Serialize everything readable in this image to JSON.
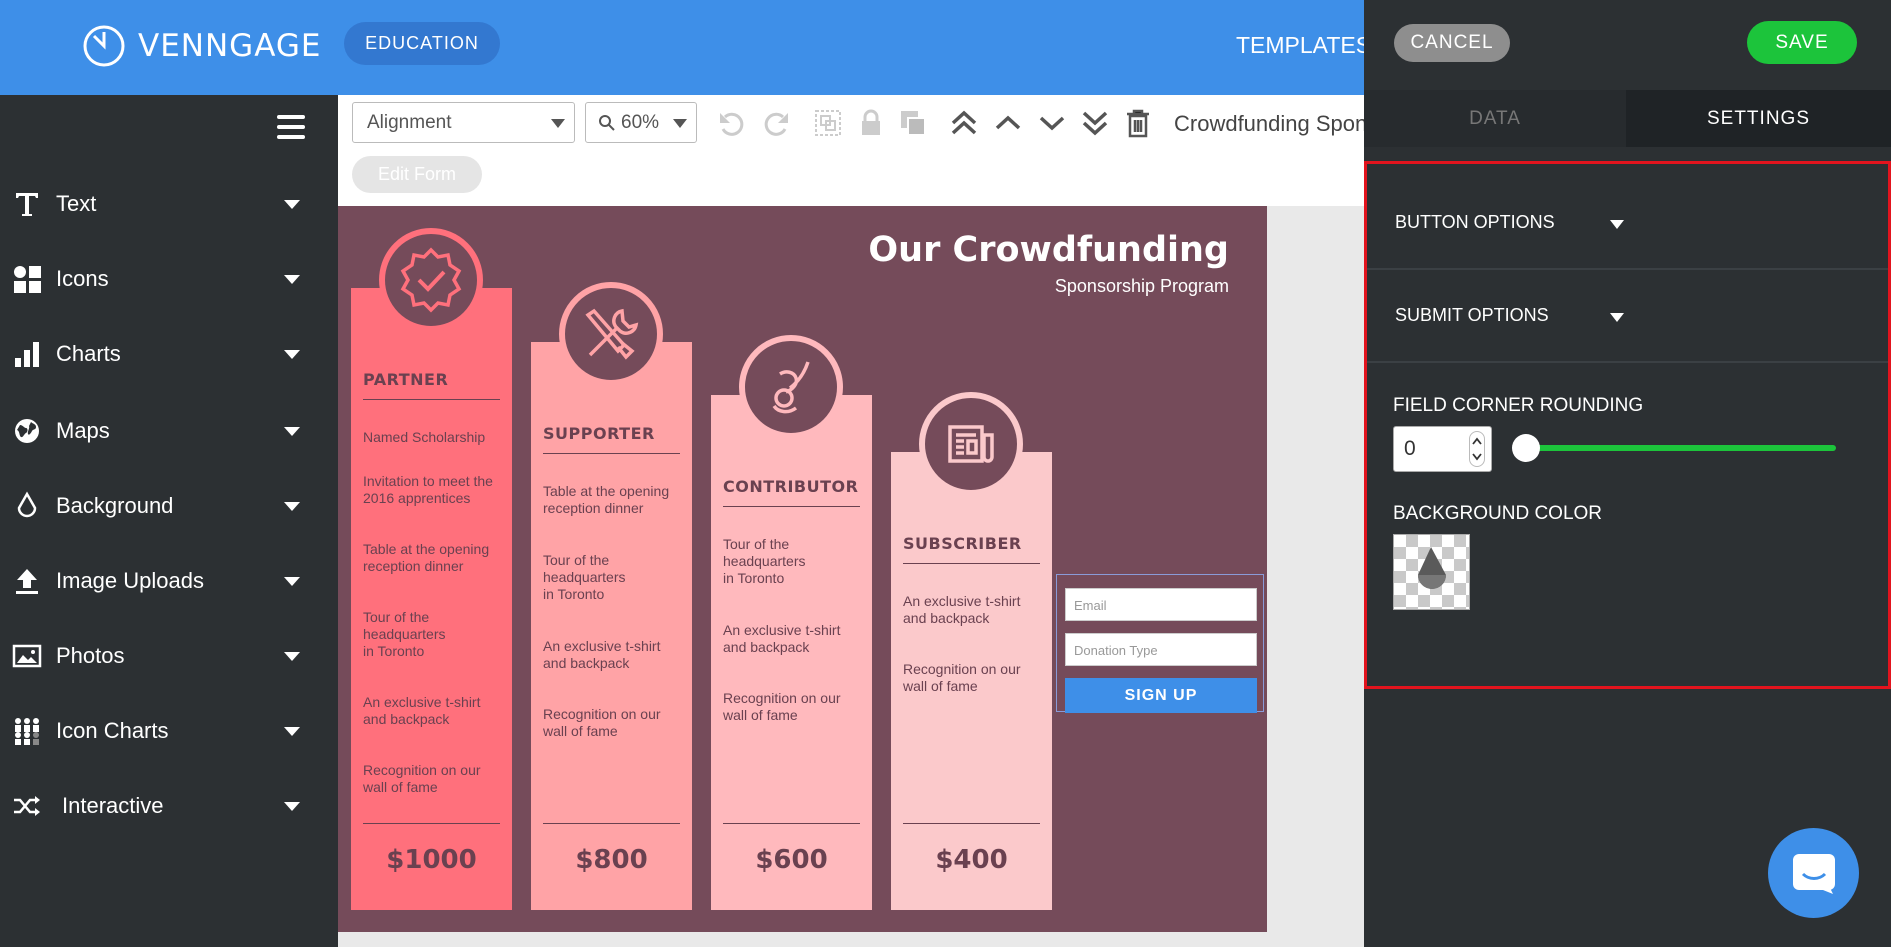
{
  "header": {
    "brand": "VENNGAGE",
    "edition_label": "EDUCATION",
    "templates_label": "TEMPLATES"
  },
  "sidebar": {
    "items": [
      {
        "label": "Text",
        "icon": "text-icon"
      },
      {
        "label": "Icons",
        "icon": "shapes-icon"
      },
      {
        "label": "Charts",
        "icon": "bar-chart-icon"
      },
      {
        "label": "Maps",
        "icon": "globe-icon"
      },
      {
        "label": "Background",
        "icon": "droplet-icon"
      },
      {
        "label": "Image Uploads",
        "icon": "upload-icon"
      },
      {
        "label": "Photos",
        "icon": "photo-icon"
      },
      {
        "label": "Icon Charts",
        "icon": "people-chart-icon"
      },
      {
        "label": "Interactive",
        "icon": "shuffle-icon"
      }
    ]
  },
  "toolbar": {
    "alignment_value": "Alignment",
    "zoom_value": "60%",
    "document_title": "Crowdfunding Spon",
    "edit_form_label": "Edit Form"
  },
  "canvas": {
    "title": "Our Crowdfunding",
    "subtitle": "Sponsorship Program",
    "tiers": [
      {
        "name": "PARTNER",
        "price": "$1000",
        "color": "#ff707c",
        "features": [
          "Named Scholarship",
          "Invitation to meet the 2016 apprentices",
          "Table at the opening reception dinner",
          "Tour of the headquarters in Toronto",
          "An exclusive t-shirt and backpack",
          "Recognition on our wall of fame"
        ]
      },
      {
        "name": "SUPPORTER",
        "price": "$800",
        "color": "#ffa3a6",
        "features": [
          "Table at the opening reception dinner",
          "Tour of the headquarters in Toronto",
          "An exclusive t-shirt and backpack",
          "Recognition on our wall of fame"
        ]
      },
      {
        "name": "CONTRIBUTOR",
        "price": "$600",
        "color": "#ffb9bd",
        "features": [
          "Tour of the headquarters in Toronto",
          "An exclusive t-shirt and backpack",
          "Recognition on our wall of fame"
        ]
      },
      {
        "name": "SUBSCRIBER",
        "price": "$400",
        "color": "#fbc9cb",
        "features": [
          "An exclusive t-shirt and backpack",
          "Recognition on our wall of fame"
        ]
      }
    ],
    "form": {
      "email_placeholder": "Email",
      "donation_placeholder": "Donation Type",
      "submit_label": "SIGN UP"
    }
  },
  "panel": {
    "cancel_label": "CANCEL",
    "save_label": "SAVE",
    "tabs": [
      "DATA",
      "SETTINGS"
    ],
    "active_tab": "SETTINGS",
    "button_options_label": "BUTTON OPTIONS",
    "submit_options_label": "SUBMIT OPTIONS",
    "field_corner_rounding_label": "FIELD CORNER ROUNDING",
    "field_corner_rounding_value": "0",
    "background_color_label": "BACKGROUND COLOR"
  },
  "colors": {
    "header_blue": "#3e8fe8",
    "save_green": "#1cc43b",
    "canvas_bg": "#754b5a",
    "highlight_red": "#e2141e"
  }
}
